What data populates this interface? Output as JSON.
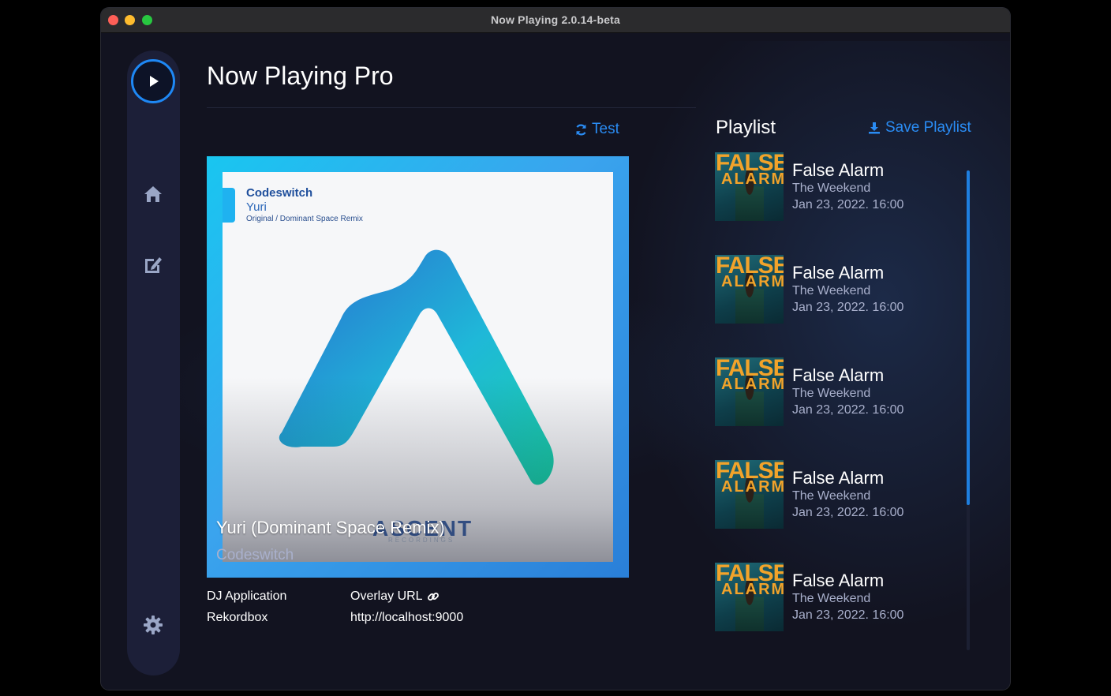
{
  "window": {
    "title": "Now Playing 2.0.14-beta"
  },
  "sidebar": {
    "items": [
      {
        "icon": "play-icon"
      },
      {
        "icon": "home-icon"
      },
      {
        "icon": "edit-icon"
      },
      {
        "icon": "gear-icon"
      }
    ]
  },
  "main": {
    "title": "Now Playing Pro",
    "test_label": "Test",
    "now_playing": {
      "title": "Yuri (Dominant Space Remix)",
      "artist": "Codeswitch",
      "art": {
        "artist": "Codeswitch",
        "track": "Yuri",
        "mix": "Original / Dominant Space Remix",
        "label": "ASCENT",
        "label_sub": "RECORDINGS"
      }
    },
    "info": {
      "dj_application_label": "DJ Application",
      "dj_application_value": "Rekordbox",
      "overlay_url_label": "Overlay URL",
      "overlay_url_value": "http://localhost:9000"
    }
  },
  "playlist": {
    "title": "Playlist",
    "save_label": "Save Playlist",
    "items": [
      {
        "title": "False Alarm",
        "artist": "The Weekend",
        "time": "Jan 23, 2022. 16:00",
        "art_word": "FALSE",
        "art_word2": "ALARM"
      },
      {
        "title": "False Alarm",
        "artist": "The Weekend",
        "time": "Jan 23, 2022. 16:00",
        "art_word": "FALSE",
        "art_word2": "ALARM"
      },
      {
        "title": "False Alarm",
        "artist": "The Weekend",
        "time": "Jan 23, 2022. 16:00",
        "art_word": "FALSE",
        "art_word2": "ALARM"
      },
      {
        "title": "False Alarm",
        "artist": "The Weekend",
        "time": "Jan 23, 2022. 16:00",
        "art_word": "FALSE",
        "art_word2": "ALARM"
      },
      {
        "title": "False Alarm",
        "artist": "The Weekend",
        "time": "Jan 23, 2022. 16:00",
        "art_word": "FALSE",
        "art_word2": "ALARM"
      }
    ]
  },
  "colors": {
    "accent": "#1e88f5",
    "link": "#2a8cf4",
    "background": "#121320",
    "sidebar": "#1c1f38"
  }
}
